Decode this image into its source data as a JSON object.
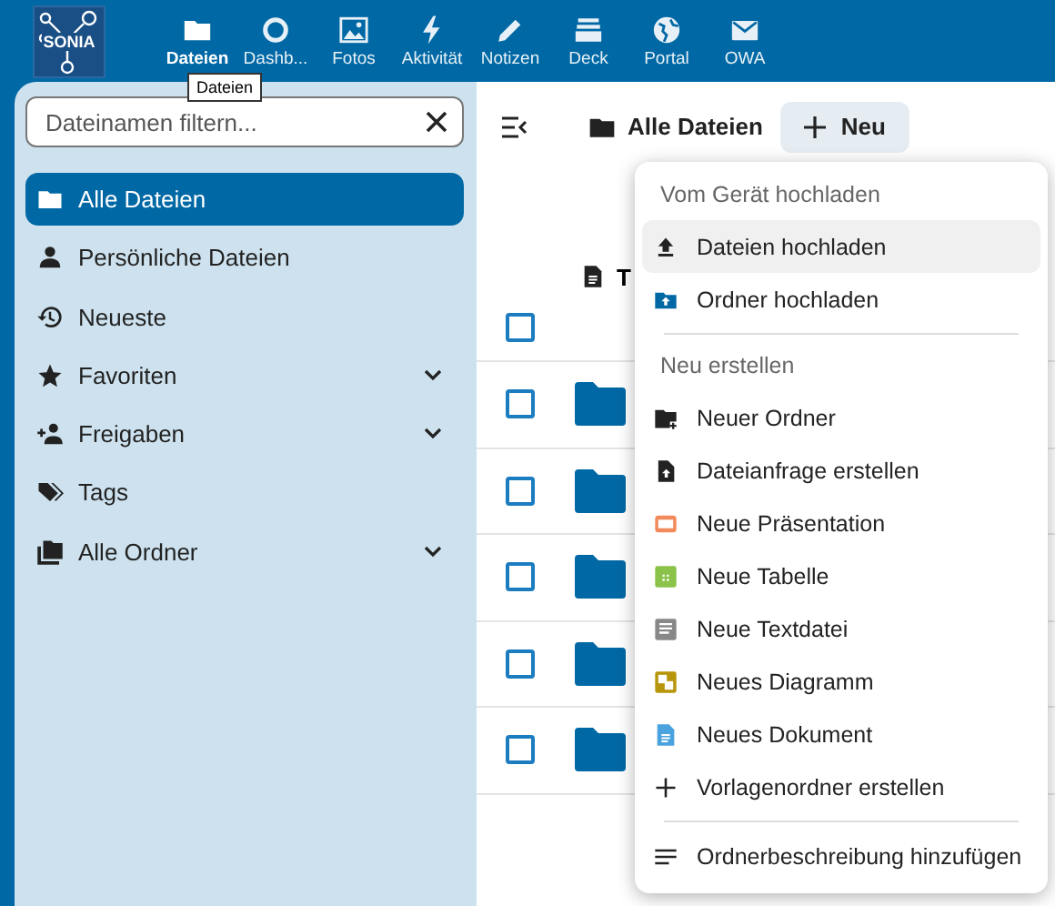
{
  "header": {
    "logo": "SONIA",
    "apps": [
      {
        "label": "Dateien",
        "kind": "folder",
        "selected": true
      },
      {
        "label": "Dashb...",
        "kind": "circle",
        "selected": false
      },
      {
        "label": "Fotos",
        "kind": "image",
        "selected": false
      },
      {
        "label": "Aktivität",
        "kind": "bolt",
        "selected": false
      },
      {
        "label": "Notizen",
        "kind": "pencil",
        "selected": false
      },
      {
        "label": "Deck",
        "kind": "deck",
        "selected": false
      },
      {
        "label": "Portal",
        "kind": "globe",
        "selected": false
      },
      {
        "label": "OWA",
        "kind": "mail",
        "selected": false
      }
    ],
    "tooltip": "Dateien"
  },
  "sidebar": {
    "filter": {
      "placeholder": "Dateinamen filtern..."
    },
    "items": [
      {
        "label": "Alle Dateien",
        "kind": "folder",
        "selected": true,
        "collapsible": false
      },
      {
        "label": "Persönliche Dateien",
        "kind": "person",
        "selected": false,
        "collapsible": false
      },
      {
        "label": "Neueste",
        "kind": "history",
        "selected": false,
        "collapsible": false
      },
      {
        "label": "Favoriten",
        "kind": "star",
        "selected": false,
        "collapsible": true
      },
      {
        "label": "Freigaben",
        "kind": "share",
        "selected": false,
        "collapsible": true
      },
      {
        "label": "Tags",
        "kind": "tag",
        "selected": false,
        "collapsible": false
      },
      {
        "label": "Alle Ordner",
        "kind": "folders",
        "selected": false,
        "collapsible": true
      }
    ]
  },
  "main": {
    "breadcrumb": "Alle Dateien",
    "new_button": "Neu",
    "column_header": "T",
    "header_checkbox": {
      "checked": false
    },
    "rows": [
      {
        "checked": false
      },
      {
        "checked": false
      },
      {
        "checked": false
      },
      {
        "checked": false
      },
      {
        "checked": false
      }
    ]
  },
  "menu": {
    "sections": [
      {
        "heading": "Vom Gerät hochladen",
        "items": [
          {
            "label": "Dateien hochladen",
            "kind": "upload",
            "highlighted": true
          },
          {
            "label": "Ordner hochladen",
            "kind": "folder-upload",
            "highlighted": false
          }
        ]
      },
      {
        "heading": "Neu erstellen",
        "items": [
          {
            "label": "Neuer Ordner",
            "kind": "folder-plus",
            "highlighted": false
          },
          {
            "label": "Dateianfrage erstellen",
            "kind": "file-upload",
            "highlighted": false
          },
          {
            "label": "Neue Präsentation",
            "kind": "presentation",
            "highlighted": false
          },
          {
            "label": "Neue Tabelle",
            "kind": "spreadsheet",
            "highlighted": false
          },
          {
            "label": "Neue Textdatei",
            "kind": "text",
            "highlighted": false
          },
          {
            "label": "Neues Diagramm",
            "kind": "diagram",
            "highlighted": false
          },
          {
            "label": "Neues Dokument",
            "kind": "document",
            "highlighted": false
          },
          {
            "label": "Vorlagenordner erstellen",
            "kind": "plus",
            "highlighted": false
          }
        ]
      },
      {
        "items": [
          {
            "label": "Ordnerbeschreibung hinzufügen",
            "kind": "lines",
            "highlighted": false
          }
        ]
      }
    ]
  }
}
